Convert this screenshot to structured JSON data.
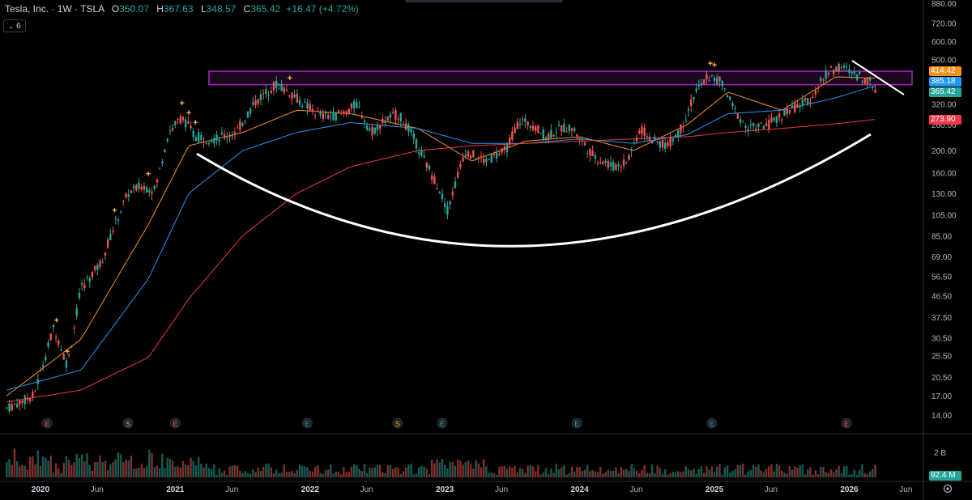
{
  "header": {
    "title": "Tesla, Inc. · 1W · TSLA",
    "o_key": "O",
    "o_val": "350.07",
    "h_key": "H",
    "h_val": "367.63",
    "l_key": "L",
    "l_val": "348.57",
    "c_key": "C",
    "c_val": "365.42",
    "change": "+16.47 (+4.72%)",
    "indicator_count": "6"
  },
  "badges": {
    "ma_orange": "414.42",
    "ma_blue": "385.18",
    "last_price": "365.42",
    "ma_red": "273.90",
    "volume": "92.4 M"
  },
  "colors": {
    "up": "#26a69a",
    "down": "#ef5350",
    "ma_orange": "#f7931a",
    "ma_blue": "#2196f3",
    "ma_red": "#f23645",
    "box": "#9c27b0",
    "marker": "#ffb74d"
  },
  "chart_data": {
    "type": "line",
    "title": "Tesla, Inc. · 1W · TSLA",
    "y_scale": "log",
    "ylim": [
      12,
      880
    ],
    "y_ticks": [
      "880.00",
      "720.00",
      "600.00",
      "500.00",
      "400.00",
      "320.00",
      "260.00",
      "200.00",
      "160.00",
      "130.00",
      "105.00",
      "85.00",
      "69.00",
      "56.50",
      "46.50",
      "37.50",
      "30.50",
      "25.50",
      "20.50",
      "17.00",
      "14.00"
    ],
    "x_ticks": [
      "2020",
      "Jun",
      "2021",
      "Jun",
      "2022",
      "Jun",
      "2023",
      "Jun",
      "2024",
      "Jun",
      "2025",
      "Jun",
      "2026",
      "Jun"
    ],
    "xlim": [
      2019.7,
      2026.55
    ],
    "series": [
      {
        "name": "close",
        "x": [
          2019.75,
          2019.95,
          2020.1,
          2020.2,
          2020.3,
          2020.45,
          2020.55,
          2020.65,
          2020.75,
          2020.85,
          2020.95,
          2021.05,
          2021.15,
          2021.3,
          2021.45,
          2021.6,
          2021.75,
          2021.85,
          2021.95,
          2022.1,
          2022.25,
          2022.35,
          2022.45,
          2022.55,
          2022.65,
          2022.75,
          2022.85,
          2022.95,
          2023.02,
          2023.15,
          2023.3,
          2023.45,
          2023.55,
          2023.65,
          2023.75,
          2023.85,
          2023.95,
          2024.1,
          2024.25,
          2024.35,
          2024.45,
          2024.55,
          2024.65,
          2024.75,
          2024.85,
          2024.95,
          2025.05,
          2025.15,
          2025.25,
          2025.4,
          2025.55,
          2025.7,
          2025.85,
          2025.95,
          2026.05,
          2026.15,
          2026.2
        ],
        "values": [
          15,
          17,
          34,
          23,
          50,
          65,
          95,
          130,
          140,
          135,
          240,
          280,
          230,
          225,
          240,
          330,
          390,
          360,
          320,
          280,
          290,
          320,
          240,
          270,
          290,
          240,
          180,
          140,
          110,
          200,
          180,
          200,
          270,
          260,
          230,
          250,
          250,
          190,
          170,
          180,
          250,
          220,
          210,
          250,
          350,
          420,
          400,
          300,
          250,
          260,
          300,
          330,
          450,
          460,
          430,
          400,
          365
        ]
      },
      {
        "name": "",
        "x": [
          2019.75,
          2020.3,
          2020.8,
          2021.1,
          2021.5,
          2021.9,
          2022.3,
          2022.8,
          2023.2,
          2023.6,
          2024.0,
          2024.4,
          2024.8,
          2025.1,
          2025.5,
          2025.9,
          2026.2
        ],
        "values": [
          17,
          30,
          95,
          210,
          240,
          300,
          290,
          250,
          180,
          220,
          230,
          200,
          260,
          360,
          300,
          420,
          414
        ]
      },
      {
        "name": "",
        "x": [
          2019.75,
          2020.3,
          2020.8,
          2021.1,
          2021.5,
          2021.9,
          2022.3,
          2022.8,
          2023.2,
          2023.6,
          2024.0,
          2024.4,
          2024.8,
          2025.1,
          2025.5,
          2025.9,
          2026.2
        ],
        "values": [
          18,
          22,
          55,
          130,
          200,
          240,
          265,
          250,
          215,
          215,
          225,
          215,
          235,
          290,
          300,
          340,
          385
        ]
      },
      {
        "name": "",
        "x": [
          2019.75,
          2020.3,
          2020.8,
          2021.1,
          2021.5,
          2021.9,
          2022.3,
          2022.8,
          2023.2,
          2023.6,
          2024.0,
          2024.4,
          2024.8,
          2025.1,
          2025.5,
          2025.9,
          2026.2
        ],
        "values": [
          16,
          18,
          25,
          45,
          85,
          130,
          170,
          200,
          210,
          215,
          220,
          225,
          230,
          240,
          250,
          262,
          274
        ]
      }
    ],
    "resistance_zone": [
      388,
      444
    ],
    "events": [
      {
        "x": 2020.05,
        "label": "E"
      },
      {
        "x": 2020.65,
        "label": "S"
      },
      {
        "x": 2021.0,
        "label": "E"
      },
      {
        "x": 2021.98,
        "label": "E"
      },
      {
        "x": 2022.65,
        "label": "S"
      },
      {
        "x": 2022.98,
        "label": "E"
      },
      {
        "x": 2023.98,
        "label": "E"
      },
      {
        "x": 2024.98,
        "label": "E"
      },
      {
        "x": 2025.98,
        "label": "E"
      }
    ],
    "volume_label": "2 B"
  }
}
